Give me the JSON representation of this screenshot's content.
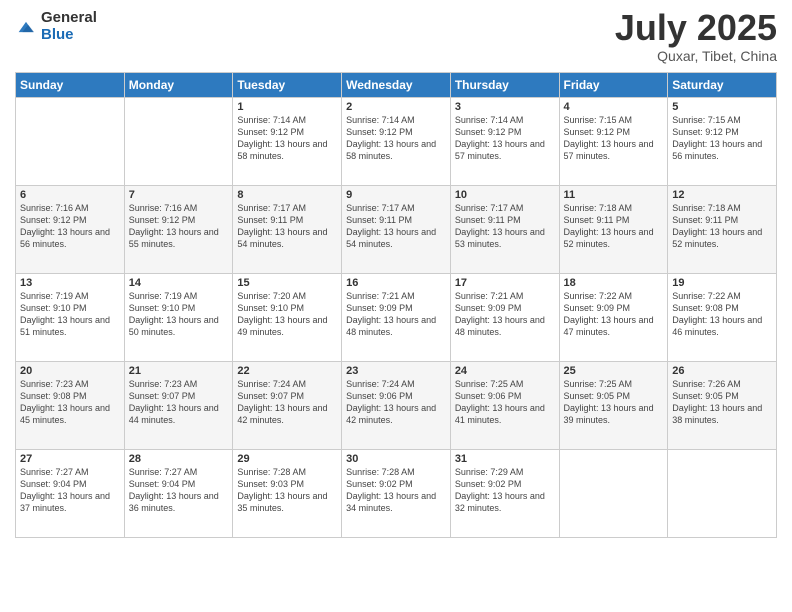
{
  "logo": {
    "general": "General",
    "blue": "Blue"
  },
  "title": "July 2025",
  "subtitle": "Quxar, Tibet, China",
  "days_of_week": [
    "Sunday",
    "Monday",
    "Tuesday",
    "Wednesday",
    "Thursday",
    "Friday",
    "Saturday"
  ],
  "weeks": [
    [
      {
        "day": "",
        "sunrise": "",
        "sunset": "",
        "daylight": ""
      },
      {
        "day": "",
        "sunrise": "",
        "sunset": "",
        "daylight": ""
      },
      {
        "day": "1",
        "sunrise": "Sunrise: 7:14 AM",
        "sunset": "Sunset: 9:12 PM",
        "daylight": "Daylight: 13 hours and 58 minutes."
      },
      {
        "day": "2",
        "sunrise": "Sunrise: 7:14 AM",
        "sunset": "Sunset: 9:12 PM",
        "daylight": "Daylight: 13 hours and 58 minutes."
      },
      {
        "day": "3",
        "sunrise": "Sunrise: 7:14 AM",
        "sunset": "Sunset: 9:12 PM",
        "daylight": "Daylight: 13 hours and 57 minutes."
      },
      {
        "day": "4",
        "sunrise": "Sunrise: 7:15 AM",
        "sunset": "Sunset: 9:12 PM",
        "daylight": "Daylight: 13 hours and 57 minutes."
      },
      {
        "day": "5",
        "sunrise": "Sunrise: 7:15 AM",
        "sunset": "Sunset: 9:12 PM",
        "daylight": "Daylight: 13 hours and 56 minutes."
      }
    ],
    [
      {
        "day": "6",
        "sunrise": "Sunrise: 7:16 AM",
        "sunset": "Sunset: 9:12 PM",
        "daylight": "Daylight: 13 hours and 56 minutes."
      },
      {
        "day": "7",
        "sunrise": "Sunrise: 7:16 AM",
        "sunset": "Sunset: 9:12 PM",
        "daylight": "Daylight: 13 hours and 55 minutes."
      },
      {
        "day": "8",
        "sunrise": "Sunrise: 7:17 AM",
        "sunset": "Sunset: 9:11 PM",
        "daylight": "Daylight: 13 hours and 54 minutes."
      },
      {
        "day": "9",
        "sunrise": "Sunrise: 7:17 AM",
        "sunset": "Sunset: 9:11 PM",
        "daylight": "Daylight: 13 hours and 54 minutes."
      },
      {
        "day": "10",
        "sunrise": "Sunrise: 7:17 AM",
        "sunset": "Sunset: 9:11 PM",
        "daylight": "Daylight: 13 hours and 53 minutes."
      },
      {
        "day": "11",
        "sunrise": "Sunrise: 7:18 AM",
        "sunset": "Sunset: 9:11 PM",
        "daylight": "Daylight: 13 hours and 52 minutes."
      },
      {
        "day": "12",
        "sunrise": "Sunrise: 7:18 AM",
        "sunset": "Sunset: 9:11 PM",
        "daylight": "Daylight: 13 hours and 52 minutes."
      }
    ],
    [
      {
        "day": "13",
        "sunrise": "Sunrise: 7:19 AM",
        "sunset": "Sunset: 9:10 PM",
        "daylight": "Daylight: 13 hours and 51 minutes."
      },
      {
        "day": "14",
        "sunrise": "Sunrise: 7:19 AM",
        "sunset": "Sunset: 9:10 PM",
        "daylight": "Daylight: 13 hours and 50 minutes."
      },
      {
        "day": "15",
        "sunrise": "Sunrise: 7:20 AM",
        "sunset": "Sunset: 9:10 PM",
        "daylight": "Daylight: 13 hours and 49 minutes."
      },
      {
        "day": "16",
        "sunrise": "Sunrise: 7:21 AM",
        "sunset": "Sunset: 9:09 PM",
        "daylight": "Daylight: 13 hours and 48 minutes."
      },
      {
        "day": "17",
        "sunrise": "Sunrise: 7:21 AM",
        "sunset": "Sunset: 9:09 PM",
        "daylight": "Daylight: 13 hours and 48 minutes."
      },
      {
        "day": "18",
        "sunrise": "Sunrise: 7:22 AM",
        "sunset": "Sunset: 9:09 PM",
        "daylight": "Daylight: 13 hours and 47 minutes."
      },
      {
        "day": "19",
        "sunrise": "Sunrise: 7:22 AM",
        "sunset": "Sunset: 9:08 PM",
        "daylight": "Daylight: 13 hours and 46 minutes."
      }
    ],
    [
      {
        "day": "20",
        "sunrise": "Sunrise: 7:23 AM",
        "sunset": "Sunset: 9:08 PM",
        "daylight": "Daylight: 13 hours and 45 minutes."
      },
      {
        "day": "21",
        "sunrise": "Sunrise: 7:23 AM",
        "sunset": "Sunset: 9:07 PM",
        "daylight": "Daylight: 13 hours and 44 minutes."
      },
      {
        "day": "22",
        "sunrise": "Sunrise: 7:24 AM",
        "sunset": "Sunset: 9:07 PM",
        "daylight": "Daylight: 13 hours and 42 minutes."
      },
      {
        "day": "23",
        "sunrise": "Sunrise: 7:24 AM",
        "sunset": "Sunset: 9:06 PM",
        "daylight": "Daylight: 13 hours and 42 minutes."
      },
      {
        "day": "24",
        "sunrise": "Sunrise: 7:25 AM",
        "sunset": "Sunset: 9:06 PM",
        "daylight": "Daylight: 13 hours and 41 minutes."
      },
      {
        "day": "25",
        "sunrise": "Sunrise: 7:25 AM",
        "sunset": "Sunset: 9:05 PM",
        "daylight": "Daylight: 13 hours and 39 minutes."
      },
      {
        "day": "26",
        "sunrise": "Sunrise: 7:26 AM",
        "sunset": "Sunset: 9:05 PM",
        "daylight": "Daylight: 13 hours and 38 minutes."
      }
    ],
    [
      {
        "day": "27",
        "sunrise": "Sunrise: 7:27 AM",
        "sunset": "Sunset: 9:04 PM",
        "daylight": "Daylight: 13 hours and 37 minutes."
      },
      {
        "day": "28",
        "sunrise": "Sunrise: 7:27 AM",
        "sunset": "Sunset: 9:04 PM",
        "daylight": "Daylight: 13 hours and 36 minutes."
      },
      {
        "day": "29",
        "sunrise": "Sunrise: 7:28 AM",
        "sunset": "Sunset: 9:03 PM",
        "daylight": "Daylight: 13 hours and 35 minutes."
      },
      {
        "day": "30",
        "sunrise": "Sunrise: 7:28 AM",
        "sunset": "Sunset: 9:02 PM",
        "daylight": "Daylight: 13 hours and 34 minutes."
      },
      {
        "day": "31",
        "sunrise": "Sunrise: 7:29 AM",
        "sunset": "Sunset: 9:02 PM",
        "daylight": "Daylight: 13 hours and 32 minutes."
      },
      {
        "day": "",
        "sunrise": "",
        "sunset": "",
        "daylight": ""
      },
      {
        "day": "",
        "sunrise": "",
        "sunset": "",
        "daylight": ""
      }
    ]
  ]
}
